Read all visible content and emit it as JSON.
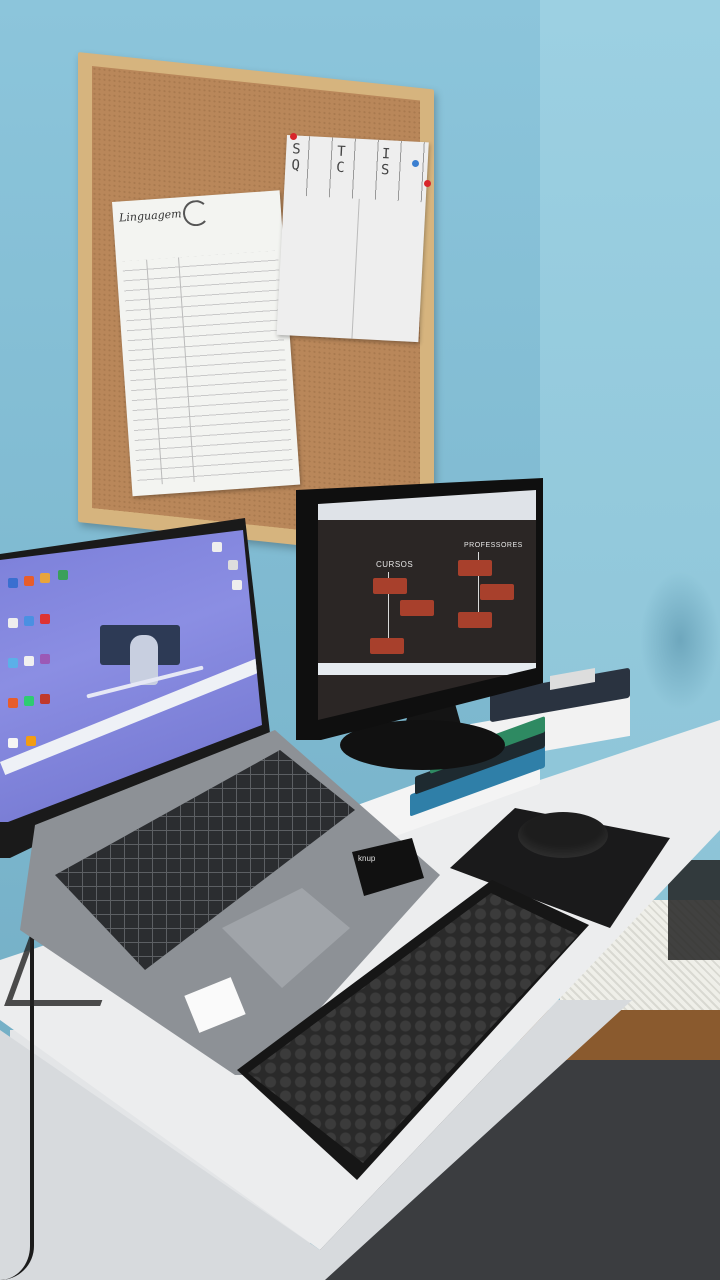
{
  "scene": {
    "description_hidden": "",
    "colors": {
      "wall": "#8cc5db",
      "cork": "#b9875a",
      "desk": "#ecedee",
      "monitor_page": "#2b2625",
      "org_box": "#a8402c",
      "laptop_wallpaper": "#7b7fd9"
    }
  },
  "corkboard": {
    "paper_left_title": "Linguagem",
    "paper_right_letters": "S T I Q C S"
  },
  "monitor": {
    "org_left_header": "CURSOS",
    "org_right_header": "PROFESSORES"
  },
  "laptop": {
    "numpad_brand": "knup",
    "sticker_icon": "intel-sticker-icon"
  }
}
